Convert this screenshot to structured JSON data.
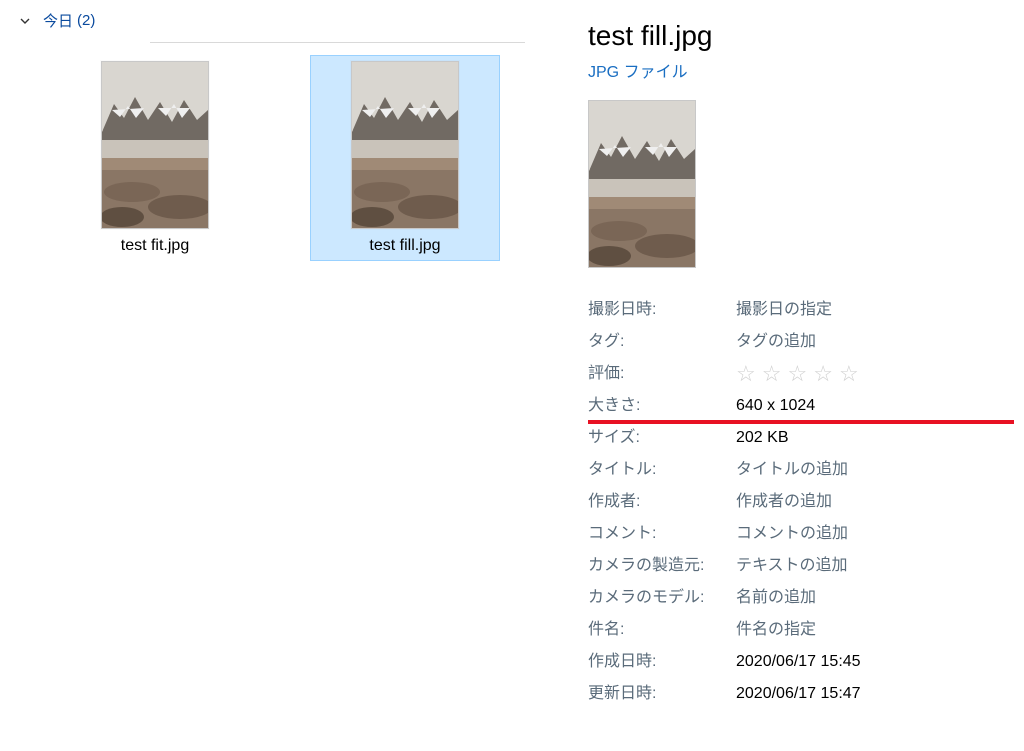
{
  "group": {
    "label": "今日",
    "count": "(2)"
  },
  "items": [
    {
      "name": "test fit.jpg"
    },
    {
      "name": "test fill.jpg"
    }
  ],
  "details": {
    "title": "test fill.jpg",
    "subtitle": "JPG ファイル",
    "rows": [
      {
        "label": "撮影日時:",
        "value": "撮影日の指定",
        "placeholder": true
      },
      {
        "label": "タグ:",
        "value": "タグの追加",
        "placeholder": true
      },
      {
        "label": "評価:",
        "value": "",
        "rating": true
      },
      {
        "label": "大きさ:",
        "value": "640 x 1024",
        "highlight": true
      },
      {
        "label": "サイズ:",
        "value": "202 KB"
      },
      {
        "label": "タイトル:",
        "value": "タイトルの追加",
        "placeholder": true
      },
      {
        "label": "作成者:",
        "value": "作成者の追加",
        "placeholder": true
      },
      {
        "label": "コメント:",
        "value": "コメントの追加",
        "placeholder": true
      },
      {
        "label": "カメラの製造元:",
        "value": "テキストの追加",
        "placeholder": true
      },
      {
        "label": "カメラのモデル:",
        "value": "名前の追加",
        "placeholder": true
      },
      {
        "label": "件名:",
        "value": "件名の指定",
        "placeholder": true
      },
      {
        "label": "作成日時:",
        "value": "2020/06/17 15:45"
      },
      {
        "label": "更新日時:",
        "value": "2020/06/17 15:47"
      }
    ]
  }
}
